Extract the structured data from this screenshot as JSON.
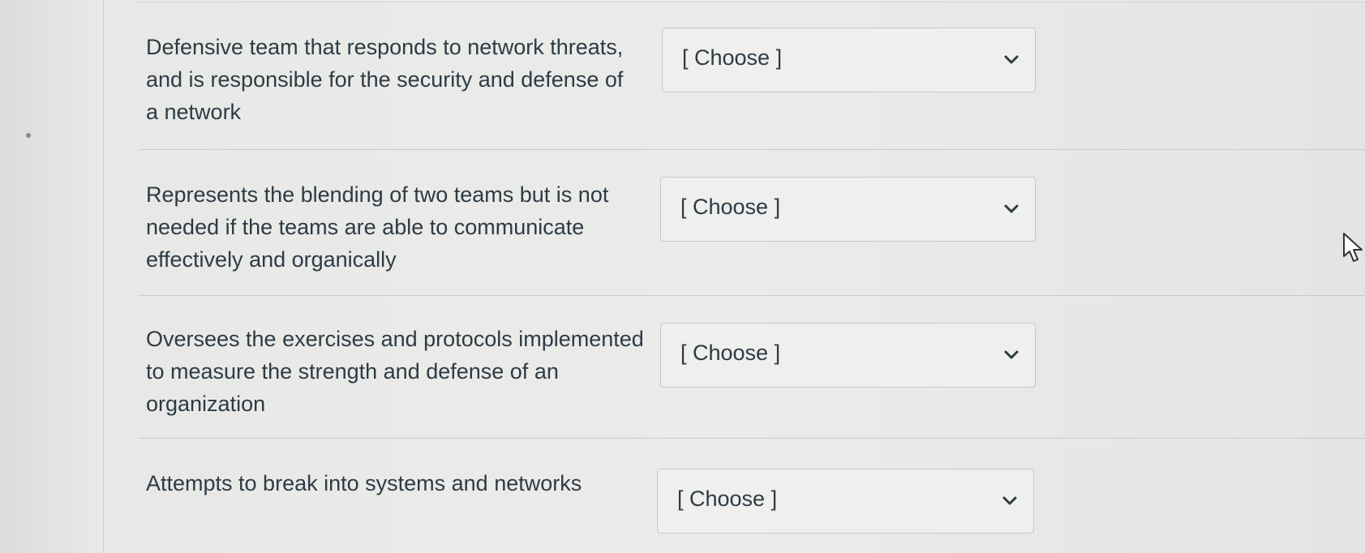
{
  "questions": [
    {
      "prompt": "Defensive team that responds to network threats, and is responsible for the security and defense of a network",
      "select_value": "[ Choose ]"
    },
    {
      "prompt": "Represents the blending of two teams but is not needed if the teams are able to communicate effectively and organically",
      "select_value": "[ Choose ]"
    },
    {
      "prompt": "Oversees the exercises and protocols implemented to measure the strength and defense of an organization",
      "select_value": "[ Choose ]"
    },
    {
      "prompt": "Attempts to break into systems and networks",
      "select_value": "[ Choose ]"
    }
  ],
  "icons": {
    "dropdown": "chevron-down-icon",
    "cursor": "mouse-pointer-icon"
  },
  "colors": {
    "text": "#2d3b45",
    "border": "#c4c8cb",
    "background": "#e9e9e7"
  }
}
